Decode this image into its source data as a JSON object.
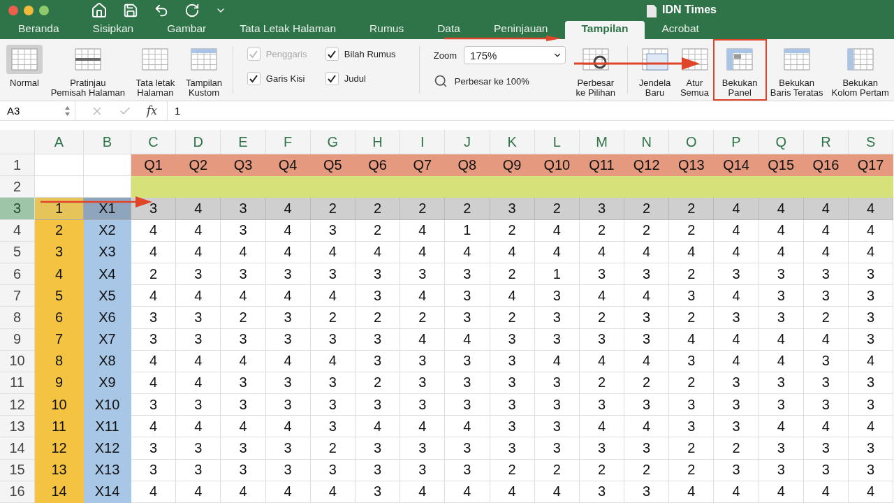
{
  "window": {
    "title": "IDN Times"
  },
  "tabs": [
    {
      "label": "Beranda",
      "selected": false
    },
    {
      "label": "Sisipkan",
      "selected": false
    },
    {
      "label": "Gambar",
      "selected": false
    },
    {
      "label": "Tata Letak Halaman",
      "selected": false
    },
    {
      "label": "Rumus",
      "selected": false
    },
    {
      "label": "Data",
      "selected": false
    },
    {
      "label": "Peninjauan",
      "selected": false
    },
    {
      "label": "Tampilan",
      "selected": true
    },
    {
      "label": "Acrobat",
      "selected": false
    }
  ],
  "ribbon": {
    "view_buttons": [
      {
        "label": "Normal",
        "selected": true
      },
      {
        "label": "Pratinjau\nPemisah Halaman",
        "selected": false
      },
      {
        "label": "Tata letak\nHalaman",
        "selected": false
      },
      {
        "label": "Tampilan\nKustom",
        "selected": false
      }
    ],
    "show_options": [
      {
        "label": "Penggaris",
        "checked": true,
        "disabled": true
      },
      {
        "label": "Bilah Rumus",
        "checked": true,
        "disabled": false
      },
      {
        "label": "Garis Kisi",
        "checked": true,
        "disabled": false
      },
      {
        "label": "Judul",
        "checked": true,
        "disabled": false
      }
    ],
    "zoom": {
      "label": "Zoom",
      "value": "175%",
      "fit_100": "Perbesar ke 100%"
    },
    "zoom_selection": "Perbesar\nke Pilihan",
    "window_buttons": [
      {
        "label": "Jendela\nBaru",
        "highlighted": false
      },
      {
        "label": "Atur\nSemua",
        "highlighted": false
      },
      {
        "label": "Bekukan\nPanel",
        "highlighted": true
      },
      {
        "label": "Bekukan\nBaris Teratas",
        "highlighted": false
      },
      {
        "label": "Bekukan\nKolom Pertam",
        "highlighted": false
      }
    ]
  },
  "formula_bar": {
    "name_box": "A3",
    "fx": "fx",
    "value": "1"
  },
  "sheet": {
    "columns": [
      "A",
      "B",
      "C",
      "D",
      "E",
      "F",
      "G",
      "H",
      "I",
      "J",
      "K",
      "L",
      "M",
      "N",
      "O",
      "P",
      "Q",
      "R",
      "S"
    ],
    "rows": [
      {
        "number": "1",
        "kind": "questions",
        "selected": false,
        "values": [
          "Q1",
          "Q2",
          "Q3",
          "Q4",
          "Q5",
          "Q6",
          "Q7",
          "Q8",
          "Q9",
          "Q10",
          "Q11",
          "Q12",
          "Q13",
          "Q14",
          "Q15",
          "Q16",
          "Q17"
        ]
      },
      {
        "number": "2",
        "kind": "band",
        "selected": false
      },
      {
        "number": "3",
        "kind": "data",
        "selected": true,
        "id": "1",
        "code": "X1",
        "values": [
          "3",
          "4",
          "3",
          "4",
          "2",
          "2",
          "2",
          "2",
          "3",
          "2",
          "3",
          "2",
          "2",
          "4",
          "4",
          "4",
          "4"
        ]
      },
      {
        "number": "4",
        "kind": "data",
        "selected": false,
        "id": "2",
        "code": "X2",
        "values": [
          "4",
          "4",
          "3",
          "4",
          "3",
          "2",
          "4",
          "1",
          "2",
          "4",
          "2",
          "2",
          "2",
          "4",
          "4",
          "4",
          "4"
        ]
      },
      {
        "number": "5",
        "kind": "data",
        "selected": false,
        "id": "3",
        "code": "X3",
        "values": [
          "4",
          "4",
          "4",
          "4",
          "4",
          "4",
          "4",
          "4",
          "4",
          "4",
          "4",
          "4",
          "4",
          "4",
          "4",
          "4",
          "4"
        ]
      },
      {
        "number": "6",
        "kind": "data",
        "selected": false,
        "id": "4",
        "code": "X4",
        "values": [
          "2",
          "3",
          "3",
          "3",
          "3",
          "3",
          "3",
          "3",
          "2",
          "1",
          "3",
          "3",
          "2",
          "3",
          "3",
          "3",
          "3"
        ]
      },
      {
        "number": "7",
        "kind": "data",
        "selected": false,
        "id": "5",
        "code": "X5",
        "values": [
          "4",
          "4",
          "4",
          "4",
          "4",
          "3",
          "4",
          "3",
          "4",
          "3",
          "4",
          "4",
          "3",
          "4",
          "3",
          "3",
          "3"
        ]
      },
      {
        "number": "8",
        "kind": "data",
        "selected": false,
        "id": "6",
        "code": "X6",
        "values": [
          "3",
          "3",
          "2",
          "3",
          "2",
          "2",
          "2",
          "3",
          "2",
          "3",
          "2",
          "3",
          "2",
          "3",
          "3",
          "2",
          "3"
        ]
      },
      {
        "number": "9",
        "kind": "data",
        "selected": false,
        "id": "7",
        "code": "X7",
        "values": [
          "3",
          "3",
          "3",
          "3",
          "3",
          "3",
          "4",
          "4",
          "3",
          "3",
          "3",
          "3",
          "4",
          "4",
          "4",
          "4",
          "3"
        ]
      },
      {
        "number": "10",
        "kind": "data",
        "selected": false,
        "id": "8",
        "code": "X8",
        "values": [
          "4",
          "4",
          "4",
          "4",
          "4",
          "3",
          "3",
          "3",
          "3",
          "4",
          "4",
          "4",
          "3",
          "4",
          "4",
          "3",
          "4"
        ]
      },
      {
        "number": "11",
        "kind": "data",
        "selected": false,
        "id": "9",
        "code": "X9",
        "values": [
          "4",
          "4",
          "3",
          "3",
          "3",
          "2",
          "3",
          "3",
          "3",
          "3",
          "2",
          "2",
          "2",
          "3",
          "3",
          "3",
          "3"
        ]
      },
      {
        "number": "12",
        "kind": "data",
        "selected": false,
        "id": "10",
        "code": "X10",
        "values": [
          "3",
          "3",
          "3",
          "3",
          "3",
          "3",
          "3",
          "3",
          "3",
          "3",
          "3",
          "3",
          "3",
          "3",
          "3",
          "3",
          "3"
        ]
      },
      {
        "number": "13",
        "kind": "data",
        "selected": false,
        "id": "11",
        "code": "X11",
        "values": [
          "4",
          "4",
          "4",
          "4",
          "3",
          "4",
          "4",
          "4",
          "3",
          "3",
          "4",
          "4",
          "3",
          "3",
          "4",
          "4",
          "4"
        ]
      },
      {
        "number": "14",
        "kind": "data",
        "selected": false,
        "id": "12",
        "code": "X12",
        "values": [
          "3",
          "3",
          "3",
          "3",
          "2",
          "3",
          "3",
          "3",
          "3",
          "3",
          "3",
          "3",
          "2",
          "2",
          "3",
          "3",
          "3"
        ]
      },
      {
        "number": "15",
        "kind": "data",
        "selected": false,
        "id": "13",
        "code": "X13",
        "values": [
          "3",
          "3",
          "3",
          "3",
          "3",
          "3",
          "3",
          "3",
          "2",
          "2",
          "2",
          "2",
          "2",
          "3",
          "3",
          "3",
          "3"
        ]
      },
      {
        "number": "16",
        "kind": "data",
        "selected": false,
        "id": "14",
        "code": "X14",
        "values": [
          "4",
          "4",
          "4",
          "4",
          "4",
          "3",
          "4",
          "4",
          "4",
          "4",
          "3",
          "3",
          "4",
          "4",
          "4",
          "4",
          "4"
        ]
      }
    ]
  }
}
